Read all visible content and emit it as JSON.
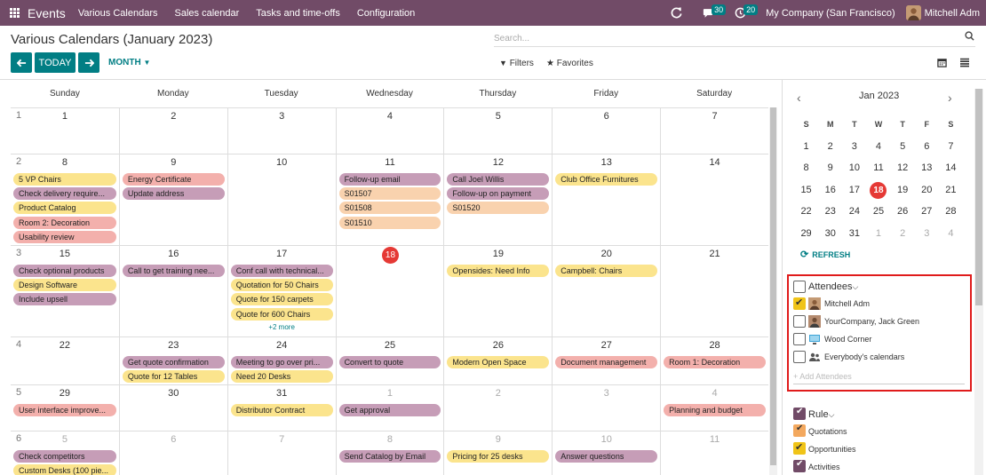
{
  "topbar": {
    "app_name": "Events",
    "menus": [
      "Various Calendars",
      "Sales calendar",
      "Tasks and time-offs",
      "Configuration"
    ],
    "chat_count": "30",
    "activity_count": "20",
    "company": "My Company (San Francisco)",
    "user": "Mitchell Adm"
  },
  "control": {
    "title": "Various Calendars (January 2023)",
    "search_placeholder": "Search...",
    "today_label": "TODAY",
    "scale_label": "MONTH",
    "filters_label": "Filters",
    "favorites_label": "Favorites"
  },
  "calendar": {
    "weekdays": [
      "Sunday",
      "Monday",
      "Tuesday",
      "Wednesday",
      "Thursday",
      "Friday",
      "Saturday"
    ],
    "weeks": [
      {
        "week": "1",
        "days": [
          {
            "d": "1",
            "events": []
          },
          {
            "d": "2",
            "events": []
          },
          {
            "d": "3",
            "events": []
          },
          {
            "d": "4",
            "events": []
          },
          {
            "d": "5",
            "events": []
          },
          {
            "d": "6",
            "events": []
          },
          {
            "d": "7",
            "events": []
          }
        ]
      },
      {
        "week": "2",
        "days": [
          {
            "d": "8",
            "events": [
              {
                "t": "5 VP Chairs",
                "c": "y"
              },
              {
                "t": "Check delivery require...",
                "c": "p"
              },
              {
                "t": "Product Catalog",
                "c": "y"
              },
              {
                "t": "Room 2: Decoration",
                "c": "r"
              },
              {
                "t": "Usability review",
                "c": "r"
              }
            ]
          },
          {
            "d": "9",
            "events": [
              {
                "t": "Energy Certificate",
                "c": "r"
              },
              {
                "t": "Update address",
                "c": "p"
              }
            ]
          },
          {
            "d": "10",
            "events": []
          },
          {
            "d": "11",
            "events": [
              {
                "t": "Follow-up email",
                "c": "p"
              },
              {
                "t": "S01507",
                "c": "o"
              },
              {
                "t": "S01508",
                "c": "o"
              },
              {
                "t": "S01510",
                "c": "o"
              }
            ]
          },
          {
            "d": "12",
            "events": [
              {
                "t": "Call Joel Willis",
                "c": "p"
              },
              {
                "t": "Follow-up on payment",
                "c": "p"
              },
              {
                "t": "S01520",
                "c": "o"
              }
            ]
          },
          {
            "d": "13",
            "events": [
              {
                "t": "Club Office Furnitures",
                "c": "y"
              }
            ]
          },
          {
            "d": "14",
            "events": []
          }
        ]
      },
      {
        "week": "3",
        "days": [
          {
            "d": "15",
            "events": [
              {
                "t": "Check optional products",
                "c": "p"
              },
              {
                "t": "Design Software",
                "c": "y"
              },
              {
                "t": "Include upsell",
                "c": "p"
              }
            ]
          },
          {
            "d": "16",
            "events": [
              {
                "t": "Call to get training nee...",
                "c": "p"
              }
            ]
          },
          {
            "d": "17",
            "events": [
              {
                "t": "Conf call with technical...",
                "c": "p"
              },
              {
                "t": "Quotation for 50 Chairs",
                "c": "y"
              },
              {
                "t": "Quote for 150 carpets",
                "c": "y"
              },
              {
                "t": "Quote for 600 Chairs",
                "c": "y"
              }
            ],
            "more": "+2 more"
          },
          {
            "d": "18",
            "today": true,
            "events": []
          },
          {
            "d": "19",
            "events": [
              {
                "t": "Opensides: Need Info",
                "c": "y"
              }
            ]
          },
          {
            "d": "20",
            "events": [
              {
                "t": "Campbell: Chairs",
                "c": "y"
              }
            ]
          },
          {
            "d": "21",
            "events": []
          }
        ]
      },
      {
        "week": "4",
        "days": [
          {
            "d": "22",
            "events": []
          },
          {
            "d": "23",
            "events": [
              {
                "t": "Get quote confirmation",
                "c": "p"
              },
              {
                "t": "Quote for 12 Tables",
                "c": "y"
              }
            ]
          },
          {
            "d": "24",
            "events": [
              {
                "t": "Meeting to go over pri...",
                "c": "p"
              },
              {
                "t": "Need 20 Desks",
                "c": "y"
              }
            ]
          },
          {
            "d": "25",
            "events": [
              {
                "t": "Convert to quote",
                "c": "p"
              }
            ]
          },
          {
            "d": "26",
            "events": [
              {
                "t": "Modern Open Space",
                "c": "y"
              }
            ]
          },
          {
            "d": "27",
            "events": [
              {
                "t": "Document management",
                "c": "r"
              }
            ]
          },
          {
            "d": "28",
            "events": [
              {
                "t": "Room 1: Decoration",
                "c": "r"
              }
            ]
          }
        ]
      },
      {
        "week": "5",
        "days": [
          {
            "d": "29",
            "events": [
              {
                "t": "User interface improve...",
                "c": "r"
              }
            ]
          },
          {
            "d": "30",
            "events": []
          },
          {
            "d": "31",
            "events": [
              {
                "t": "Distributor Contract",
                "c": "y"
              }
            ]
          },
          {
            "d": "1",
            "other": true,
            "events": [
              {
                "t": "Get approval",
                "c": "p"
              }
            ]
          },
          {
            "d": "2",
            "other": true,
            "events": []
          },
          {
            "d": "3",
            "other": true,
            "events": []
          },
          {
            "d": "4",
            "other": true,
            "events": [
              {
                "t": "Planning and budget",
                "c": "r"
              }
            ]
          }
        ]
      },
      {
        "week": "6",
        "days": [
          {
            "d": "5",
            "other": true,
            "events": [
              {
                "t": "Check competitors",
                "c": "p"
              },
              {
                "t": "Custom Desks (100 pie...",
                "c": "y"
              }
            ]
          },
          {
            "d": "6",
            "other": true,
            "events": []
          },
          {
            "d": "7",
            "other": true,
            "events": []
          },
          {
            "d": "8",
            "other": true,
            "events": [
              {
                "t": "Send Catalog by Email",
                "c": "p"
              }
            ]
          },
          {
            "d": "9",
            "other": true,
            "events": [
              {
                "t": "Pricing for 25 desks",
                "c": "y"
              }
            ]
          },
          {
            "d": "10",
            "other": true,
            "events": [
              {
                "t": "Answer questions",
                "c": "p"
              }
            ]
          },
          {
            "d": "11",
            "other": true,
            "events": []
          }
        ]
      }
    ]
  },
  "mini": {
    "title": "Jan 2023",
    "headers": [
      "S",
      "M",
      "T",
      "W",
      "T",
      "F",
      "S"
    ],
    "rows": [
      [
        {
          "d": "1"
        },
        {
          "d": "2"
        },
        {
          "d": "3"
        },
        {
          "d": "4"
        },
        {
          "d": "5"
        },
        {
          "d": "6"
        },
        {
          "d": "7"
        }
      ],
      [
        {
          "d": "8"
        },
        {
          "d": "9"
        },
        {
          "d": "10"
        },
        {
          "d": "11"
        },
        {
          "d": "12"
        },
        {
          "d": "13"
        },
        {
          "d": "14"
        }
      ],
      [
        {
          "d": "15"
        },
        {
          "d": "16"
        },
        {
          "d": "17"
        },
        {
          "d": "18",
          "today": true
        },
        {
          "d": "19"
        },
        {
          "d": "20"
        },
        {
          "d": "21"
        }
      ],
      [
        {
          "d": "22"
        },
        {
          "d": "23"
        },
        {
          "d": "24"
        },
        {
          "d": "25"
        },
        {
          "d": "26"
        },
        {
          "d": "27"
        },
        {
          "d": "28"
        }
      ],
      [
        {
          "d": "29"
        },
        {
          "d": "30"
        },
        {
          "d": "31"
        },
        {
          "d": "1",
          "other": true
        },
        {
          "d": "2",
          "other": true
        },
        {
          "d": "3",
          "other": true
        },
        {
          "d": "4",
          "other": true
        }
      ]
    ],
    "refresh_label": "REFRESH"
  },
  "attendees": {
    "title": "Attendees",
    "items": [
      {
        "label": "Mitchell Adm",
        "checked": true
      },
      {
        "label": "YourCompany, Jack Green",
        "checked": false
      },
      {
        "label": "Wood Corner",
        "checked": false
      },
      {
        "label": "Everybody's calendars",
        "checked": false
      }
    ],
    "add_placeholder": "+ Add Attendees"
  },
  "rule": {
    "title": "Rule",
    "items": [
      {
        "label": "Quotations",
        "color": "#f3a85e"
      },
      {
        "label": "Opportunities",
        "color": "#f0c418"
      },
      {
        "label": "Activities",
        "color": "#714b67"
      }
    ]
  }
}
